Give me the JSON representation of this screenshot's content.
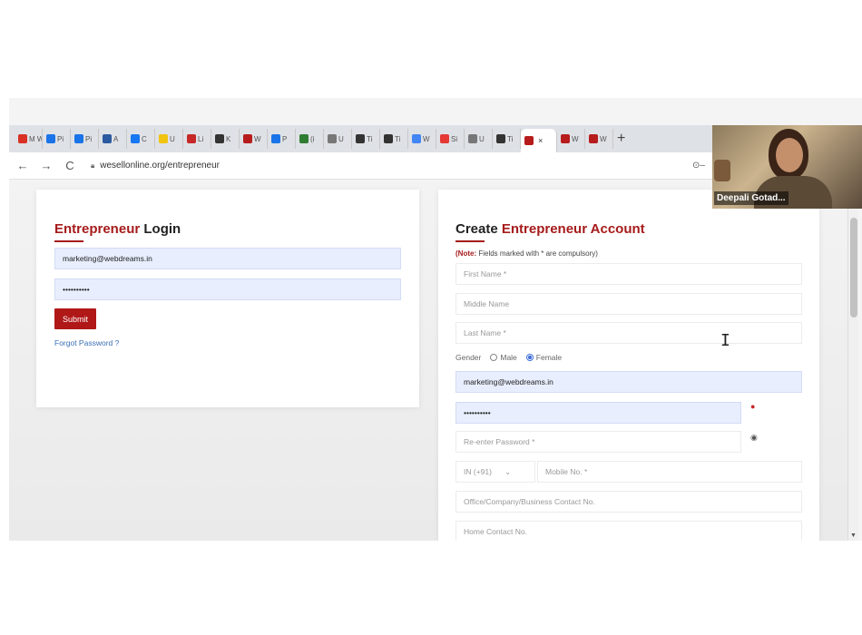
{
  "browser": {
    "tabs": [
      {
        "icon": "gmail-icon",
        "label": "M W",
        "color": "#d93025"
      },
      {
        "icon": "meet-icon",
        "label": "Pi",
        "color": "#1a73e8"
      },
      {
        "icon": "meet-icon",
        "label": "Pi",
        "color": "#1a73e8"
      },
      {
        "icon": "app-icon",
        "label": "A",
        "color": "#2c5aa0"
      },
      {
        "icon": "facebook-icon",
        "label": "C",
        "color": "#1877f2"
      },
      {
        "icon": "star-icon",
        "label": "U",
        "color": "#f1c40f"
      },
      {
        "icon": "flag-icon",
        "label": "Li",
        "color": "#c62828"
      },
      {
        "icon": "globe-icon",
        "label": "K",
        "color": "#333333"
      },
      {
        "icon": "wesell-icon",
        "label": "W",
        "color": "#b71c1c"
      },
      {
        "icon": "meet-icon",
        "label": "P",
        "color": "#1a73e8"
      },
      {
        "icon": "green-icon",
        "label": "(i",
        "color": "#2e7d32"
      },
      {
        "icon": "eye-icon",
        "label": "U",
        "color": "#777777"
      },
      {
        "icon": "globe-icon",
        "label": "Ti",
        "color": "#333333"
      },
      {
        "icon": "globe-icon",
        "label": "Ti",
        "color": "#333333"
      },
      {
        "icon": "google-icon",
        "label": "W",
        "color": "#4285f4"
      },
      {
        "icon": "youtube-icon",
        "label": "Si",
        "color": "#e53935"
      },
      {
        "icon": "eye-icon",
        "label": "U",
        "color": "#777777"
      },
      {
        "icon": "globe-icon",
        "label": "Ti",
        "color": "#333333"
      }
    ],
    "active_tab": {
      "icon": "wesell-icon",
      "close": "×",
      "color": "#b71c1c"
    },
    "tabs_after": [
      {
        "icon": "wesell-icon",
        "label": "W",
        "color": "#b71c1c"
      },
      {
        "icon": "wesell-icon",
        "label": "W",
        "color": "#b71c1c"
      }
    ],
    "new_tab": "+",
    "back": "←",
    "forward": "→",
    "reload": "C",
    "url": "wesellonline.org/entrepreneur",
    "video_name": "Deepali Gotad..."
  },
  "login": {
    "title_red": "Entrepreneur",
    "title_dark": " Login",
    "email": "marketing@webdreams.in",
    "password": "••••••••••",
    "submit": "Submit",
    "forgot": "Forgot Password ?"
  },
  "register": {
    "title_dark": "Create ",
    "title_red": "Entrepreneur Account",
    "note_bold": "(Note:",
    "note_rest": " Fields marked with * are compulsory)",
    "first_name_ph": "First Name *",
    "middle_name_ph": "Middle Name",
    "last_name_ph": "Last Name *",
    "gender_label": "Gender",
    "male": "Male",
    "female": "Female",
    "email": "marketing@webdreams.in",
    "password": "••••••••••",
    "reenter_ph": "Re-enter Password *",
    "country_code": "IN (+91)",
    "mobile_ph": "Mobile No. *",
    "office_ph": "Office/Company/Business Contact No.",
    "home_ph": "Home Contact No."
  },
  "colors": {
    "brand_red": "#a61b1b",
    "button_red": "#b01818",
    "autofill_blue": "#e8eefd",
    "link_blue": "#3b6fb4"
  }
}
